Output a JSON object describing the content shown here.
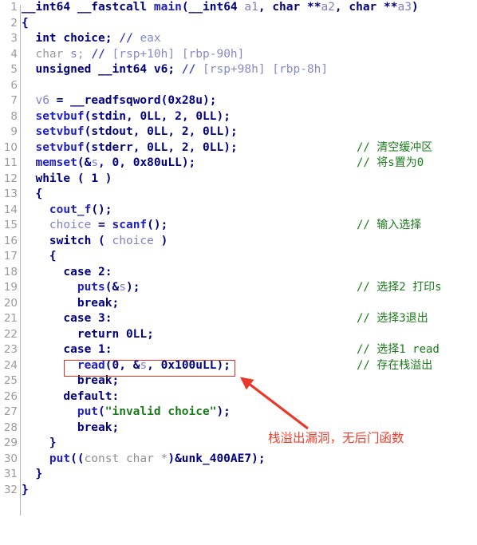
{
  "editor": {
    "title": "IDA Pseudocode - main",
    "total_lines": 32,
    "colors": {
      "keyword": "#000080",
      "function": "#2020c0",
      "local_variable": "#8080c0",
      "comment_auto": "#8888c8",
      "comment_user": "#1a7a1a",
      "string": "#1a7a1a",
      "cast": "#909090",
      "line_number": "#9a9a9a",
      "annotation_red": "#f04030",
      "background": "#ffffff"
    }
  },
  "lines": [
    {
      "n": "1",
      "code": "__int64 __fastcall main(__int64 a1, char **a2, char **a3)",
      "comment": ""
    },
    {
      "n": "2",
      "code": "{",
      "comment": ""
    },
    {
      "n": "3",
      "code": "  int choice; // eax",
      "comment": ""
    },
    {
      "n": "4",
      "code": "  char s; // [rsp+10h] [rbp-90h]",
      "comment": ""
    },
    {
      "n": "5",
      "code": "  unsigned __int64 v6; // [rsp+98h] [rbp-8h]",
      "comment": ""
    },
    {
      "n": "6",
      "code": "",
      "comment": ""
    },
    {
      "n": "7",
      "code": "  v6 = __readfsqword(0x28u);",
      "comment": ""
    },
    {
      "n": "8",
      "code": "  setvbuf(stdin, 0LL, 2, 0LL);",
      "comment": ""
    },
    {
      "n": "9",
      "code": "  setvbuf(stdout, 0LL, 2, 0LL);",
      "comment": ""
    },
    {
      "n": "10",
      "code": "  setvbuf(stderr, 0LL, 2, 0LL);",
      "comment": "// 清空缓冲区"
    },
    {
      "n": "11",
      "code": "  memset(&s, 0, 0x80uLL);",
      "comment": "// 将s置为0"
    },
    {
      "n": "12",
      "code": "  while ( 1 )",
      "comment": ""
    },
    {
      "n": "13",
      "code": "  {",
      "comment": ""
    },
    {
      "n": "14",
      "code": "    cout_f();",
      "comment": ""
    },
    {
      "n": "15",
      "code": "    choice = scanf();",
      "comment": "// 输入选择"
    },
    {
      "n": "16",
      "code": "    switch ( choice )",
      "comment": ""
    },
    {
      "n": "17",
      "code": "    {",
      "comment": ""
    },
    {
      "n": "18",
      "code": "      case 2:",
      "comment": ""
    },
    {
      "n": "19",
      "code": "        puts(&s);",
      "comment": "// 选择2 打印s"
    },
    {
      "n": "20",
      "code": "        break;",
      "comment": ""
    },
    {
      "n": "21",
      "code": "      case 3:",
      "comment": "// 选择3退出"
    },
    {
      "n": "22",
      "code": "        return 0LL;",
      "comment": ""
    },
    {
      "n": "23",
      "code": "      case 1:",
      "comment": "// 选择1 read"
    },
    {
      "n": "24",
      "code": "        read(0, &s, 0x100uLL);",
      "comment": "// 存在栈溢出"
    },
    {
      "n": "25",
      "code": "        break;",
      "comment": ""
    },
    {
      "n": "26",
      "code": "      default:",
      "comment": ""
    },
    {
      "n": "27",
      "code": "        put(\"invalid choice\");",
      "comment": ""
    },
    {
      "n": "28",
      "code": "        break;",
      "comment": ""
    },
    {
      "n": "29",
      "code": "    }",
      "comment": ""
    },
    {
      "n": "30",
      "code": "    put((const char *)&unk_400AE7);",
      "comment": ""
    },
    {
      "n": "31",
      "code": "  }",
      "comment": ""
    },
    {
      "n": "32",
      "code": "}",
      "comment": ""
    }
  ],
  "annotations": {
    "highlight_target": "read(0, &s, 0x100uLL);",
    "red_note": "栈溢出漏洞，无后门函数",
    "arrow": {
      "from": "red_note",
      "to": "highlight_target"
    }
  }
}
